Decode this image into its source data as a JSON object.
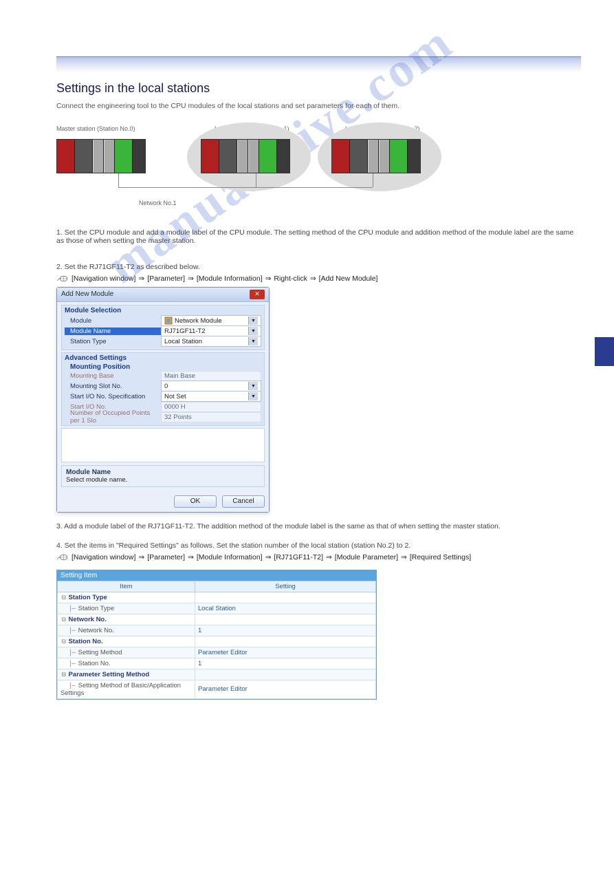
{
  "watermark": "manualshive.com",
  "section_title": "Settings in the local stations",
  "intro": "Connect the engineering tool to the CPU modules of the local stations and set parameters for each of them.",
  "diagram": {
    "labels": {
      "master": "Master station (Station No.0)",
      "network": "Network No.1",
      "local1": "Local station (Station No.1)",
      "local2": "Local station (Station No.2)"
    }
  },
  "step1": "1. Set the CPU module and add a module label of the CPU module. The setting method of the CPU module and addition method of the module label are the same as those of when setting the master station.",
  "step2": "2. Set the RJ71GF11-T2 as described below.",
  "nav1": {
    "items": [
      "[Navigation window]",
      "[Parameter]",
      "[Module Information]",
      "Right-click",
      "[Add New Module]"
    ]
  },
  "dialog": {
    "title": "Add New Module",
    "module_selection": {
      "heading": "Module Selection",
      "module_label": "Module",
      "module_value": "Network Module",
      "module_name_label": "Module Name",
      "module_name_value": "RJ71GF11-T2",
      "station_type_label": "Station Type",
      "station_type_value": "Local Station"
    },
    "advanced": {
      "heading": "Advanced Settings",
      "mounting_heading": "Mounting Position",
      "mounting_base_label": "Mounting Base",
      "mounting_base_value": "Main Base",
      "mounting_slot_label": "Mounting Slot No.",
      "mounting_slot_value": "0",
      "start_io_spec_label": "Start I/O No. Specification",
      "start_io_spec_value": "Not Set",
      "start_io_label": "Start I/O No.",
      "start_io_value": "0000 H",
      "occupied_label": "Number of Occupied Points per 1 Slo",
      "occupied_value": "32 Points"
    },
    "desc_heading": "Module Name",
    "desc_text": "Select module name.",
    "ok": "OK",
    "cancel": "Cancel"
  },
  "step3": "3. Add a module label of the RJ71GF11-T2. The addition method of the module label is the same as that of when setting the master station.",
  "step4": "4. Set the items in \"Required Settings\" as follows. Set the station number of the local station (station No.2) to 2.",
  "nav2": {
    "items": [
      "[Navigation window]",
      "[Parameter]",
      "[Module Information]",
      "[RJ71GF11-T2]",
      "[Module Parameter]",
      "[Required Settings]"
    ]
  },
  "settings": {
    "header": "Setting Item",
    "col_item": "Item",
    "col_setting": "Setting",
    "rows": [
      {
        "cat": true,
        "item": "Station Type",
        "setting": ""
      },
      {
        "item": "Station Type",
        "setting": "Local Station",
        "blue": true
      },
      {
        "cat": true,
        "item": "Network No.",
        "setting": ""
      },
      {
        "item": "Network No.",
        "setting": "1",
        "blue": true
      },
      {
        "cat": true,
        "item": "Station No.",
        "setting": ""
      },
      {
        "item": "Setting Method",
        "setting": "Parameter Editor",
        "blue": true
      },
      {
        "item": "Station No.",
        "setting": "1",
        "blue": true
      },
      {
        "cat": true,
        "item": "Parameter Setting Method",
        "setting": ""
      },
      {
        "item": "Setting Method of Basic/Application Settings",
        "setting": "Parameter Editor",
        "blue": true
      }
    ]
  }
}
